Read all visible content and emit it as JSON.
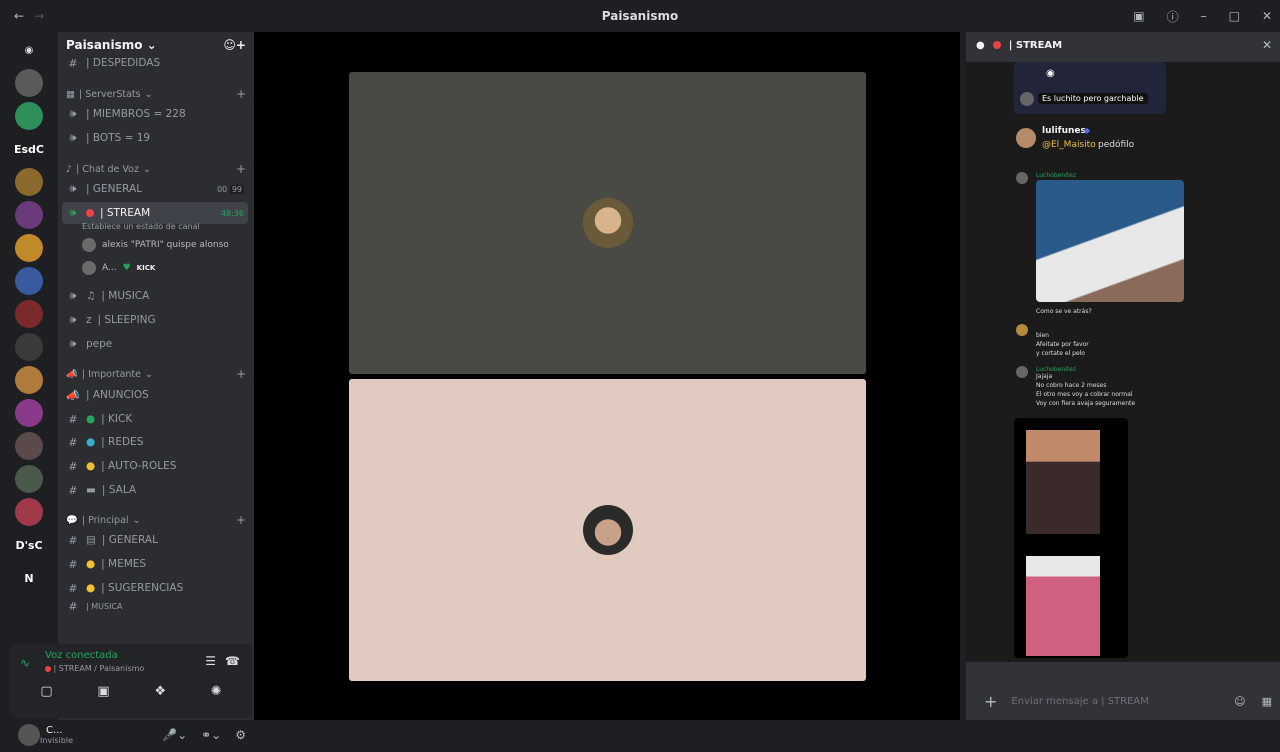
{
  "window": {
    "title": "Paisanismo"
  },
  "server": {
    "name": "Paisanismo"
  },
  "channels": {
    "partial_top": "| DESPEDIDAS",
    "serverstats": {
      "label": "| ServerStats",
      "items": [
        "| MIEMBROS = 228",
        "| BOTS = 19"
      ]
    },
    "voz": {
      "label": "| Chat de Voz",
      "general": "| GENERAL",
      "general_badge1": "00",
      "general_badge2": "99",
      "stream": "| STREAM",
      "stream_time": "48:36",
      "stream_status": "Establece un estado de canal",
      "members": [
        "alexis \"PATRI\" quispe alonso",
        "A..."
      ],
      "member_tag": "KICK",
      "musica": "| MUSICA",
      "sleeping": "| SLEEPING",
      "pepe": "pepe"
    },
    "importante": {
      "label": "| Importante",
      "items": [
        "| ANUNCIOS",
        "| KICK",
        "| REDES",
        "| AUTO-ROLES",
        "| SALA"
      ]
    },
    "principal": {
      "label": "| Principal",
      "items": [
        "| GENERAL",
        "| MEMES",
        "| SUGERENCIAS"
      ],
      "partial_bottom": "| MUSICA"
    }
  },
  "voice": {
    "status": "Voz conectada",
    "channel": "| STREAM / Paisanismo"
  },
  "user": {
    "name": "C...",
    "status": "Invisible"
  },
  "guild_texts": [
    "EsdC",
    "D'sC",
    "N"
  ],
  "chat": {
    "title": "| STREAM",
    "msg1_caption": "Es luchito pero garchable",
    "msg2_author": "lulifunes",
    "msg2_mention": "@El_Maisito",
    "msg2_text": "pedófilo",
    "msg3_author": "Luchobenitez",
    "msg3_caption": "Como se ve atrás?",
    "msg4_lines": [
      "bien",
      "Afeitate por favor",
      "y cortate el pelo"
    ],
    "msg5_author": "Luchobenitez",
    "msg5_lines": [
      "Jajaja",
      "No cobro hace 2 meses",
      "El otro mes voy a cobrar normal",
      "Voy con fiera avaja seguramente"
    ],
    "input_placeholder": "Enviar mensaje a | STREAM"
  }
}
